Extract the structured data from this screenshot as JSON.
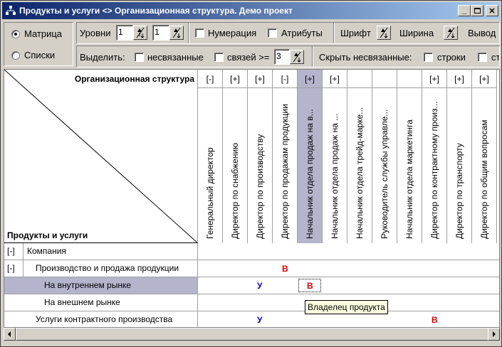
{
  "window": {
    "title": "Продукты и услуги <> Организационная структура. Демо проект",
    "icon": "org-tree-icon"
  },
  "toolbar": {
    "view_modes": [
      {
        "label": "Матрица",
        "checked": true
      },
      {
        "label": "Списки",
        "checked": false
      }
    ],
    "levels_label": "Уровни",
    "levels_value_1": "1",
    "levels_value_2": "1",
    "numbering_label": "Нумерация",
    "attributes_label": "Атрибуты",
    "font_label": "Шрифт",
    "width_label": "Ширина",
    "output_label": "Вывод",
    "select_label": "Выделить:",
    "unlinked_label": "несвязанные",
    "links_label": "связей >=",
    "links_value": "3",
    "hide_unlinked_label": "Скрыть несвязанные:",
    "rows_label": "строки",
    "cols_label": "ст"
  },
  "matrix": {
    "corner_top_label": "Организационная структура",
    "corner_bottom_label": "Продукты и услуги",
    "columns": [
      {
        "expander": "[-]",
        "label": "Генеральный директор"
      },
      {
        "expander": "[+]",
        "label": "Директор по снабжению"
      },
      {
        "expander": "[+]",
        "label": "Директор по производству"
      },
      {
        "expander": "[-]",
        "label": "Директор по продажам продукции"
      },
      {
        "expander": "[+]",
        "label": "Начальник отдела продаж на в..."
      },
      {
        "expander": "[+]",
        "label": "Начальник отдела продаж на ..."
      },
      {
        "expander": "",
        "label": "Начальник отдела трейд-марке..."
      },
      {
        "expander": "",
        "label": "Руководитель службы управле..."
      },
      {
        "expander": "",
        "label": "Начальник отдела маркетинга"
      },
      {
        "expander": "[+]",
        "label": "Директор по контрактному произ..."
      },
      {
        "expander": "[+]",
        "label": "Директор по транспорту"
      },
      {
        "expander": "[+]",
        "label": "Директор по общим вопросам"
      }
    ],
    "rows": [
      {
        "expander": "[-]",
        "label": "Компания"
      },
      {
        "expander": "[-]",
        "label": "Производство и продажа продукции"
      },
      {
        "expander": "",
        "label": "На внутреннем рынке"
      },
      {
        "expander": "",
        "label": "На внешнем рынке"
      },
      {
        "expander": "",
        "label": "Услуги контрактного производства"
      }
    ],
    "cells": [
      {
        "row": 1,
        "col": 3,
        "value": "В"
      },
      {
        "row": 2,
        "col": 2,
        "value": "У"
      },
      {
        "row": 2,
        "col": 4,
        "value": "В"
      },
      {
        "row": 4,
        "col": 2,
        "value": "У"
      },
      {
        "row": 4,
        "col": 9,
        "value": "В"
      }
    ],
    "tooltip": "Владелец продукта",
    "colors": {
      "mark_v": "#e00000",
      "mark_u": "#0000c0",
      "selected": "#b4b4cc"
    }
  }
}
